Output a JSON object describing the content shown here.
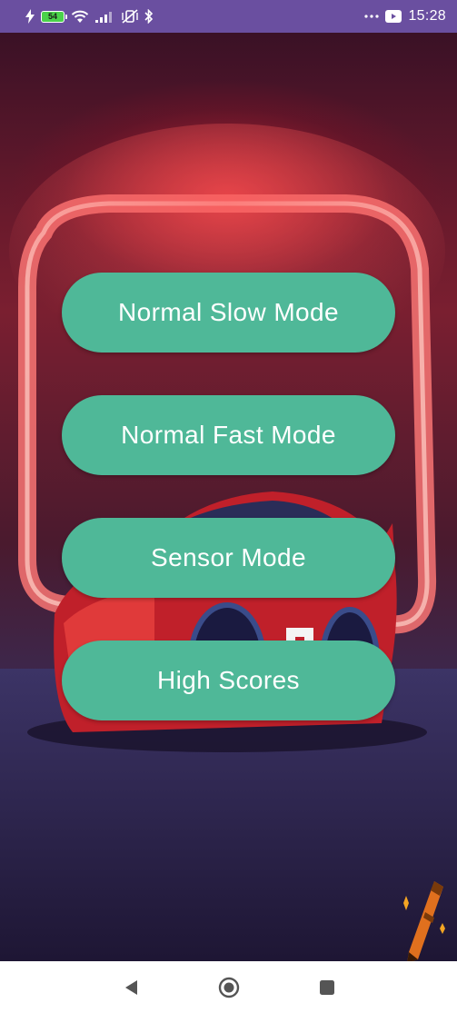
{
  "status_bar": {
    "battery_level": "54",
    "time": "15:28",
    "icons": [
      "flash-icon",
      "battery-icon",
      "wifi-icon",
      "signal-icon",
      "vibrate-off-icon",
      "bluetooth-icon",
      "more-icon",
      "youtube-icon"
    ]
  },
  "menu": {
    "buttons": [
      {
        "label": "Normal Slow Mode"
      },
      {
        "label": "Normal Fast Mode"
      },
      {
        "label": "Sensor Mode"
      },
      {
        "label": "High Scores"
      }
    ],
    "button_color": "#4fb898"
  },
  "nav_bar": {
    "icons": [
      "back-icon",
      "home-icon",
      "recents-icon"
    ]
  }
}
